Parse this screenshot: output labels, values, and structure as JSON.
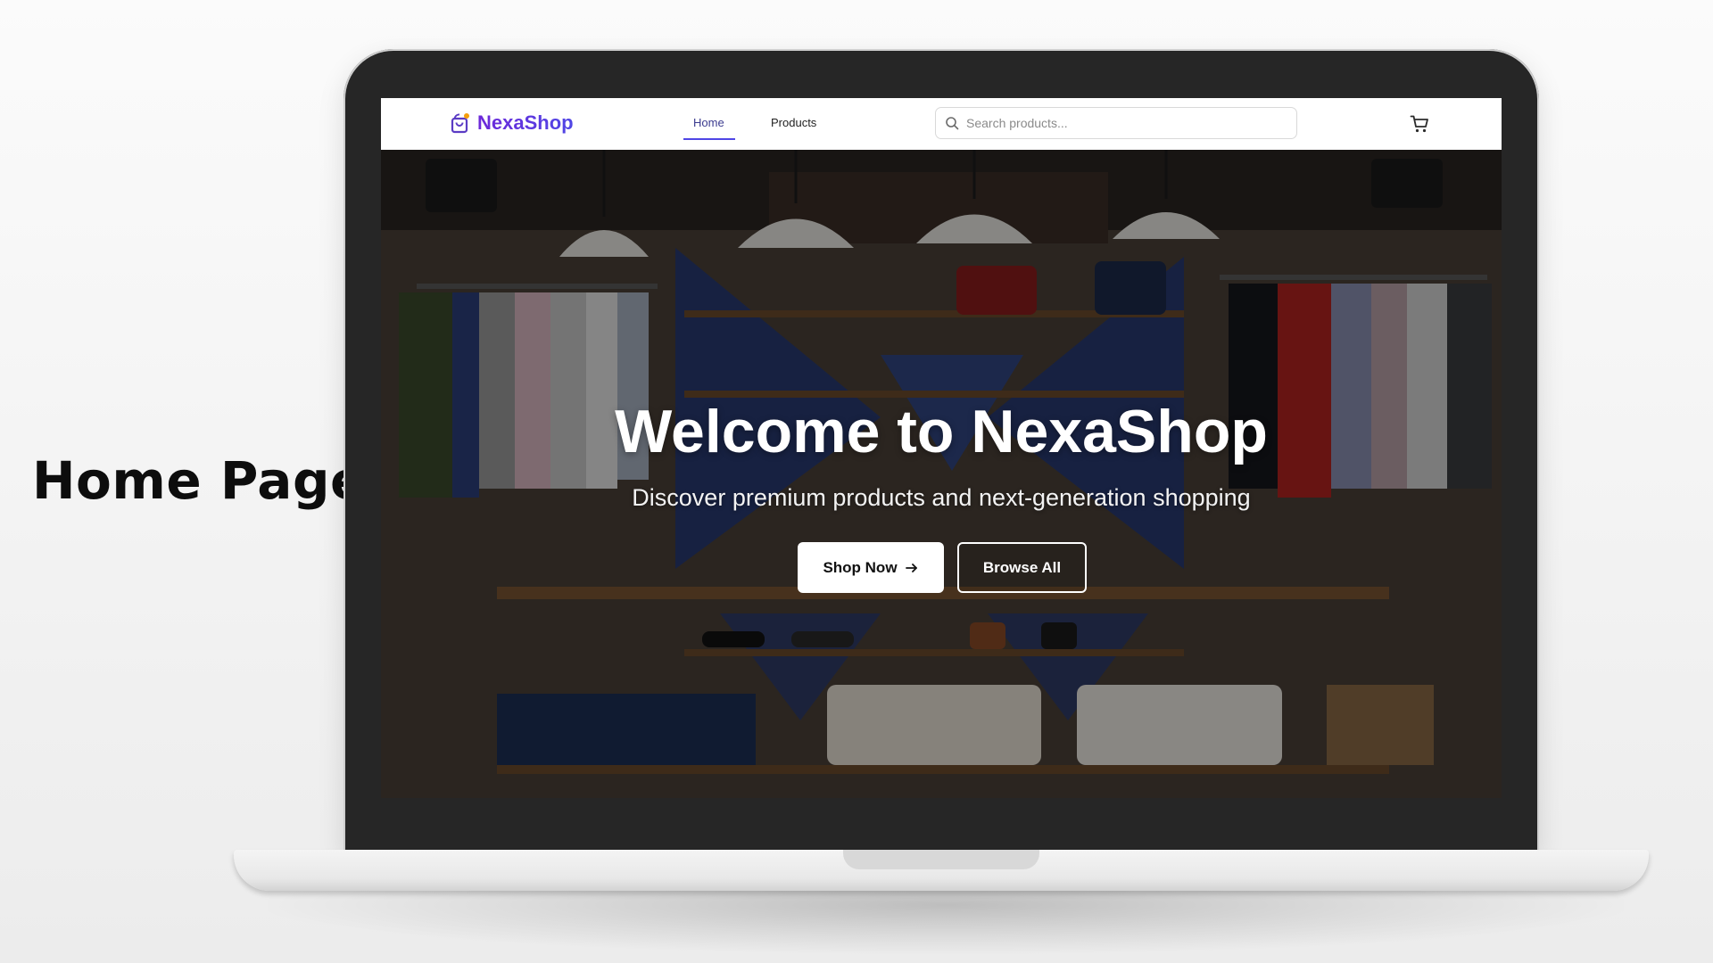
{
  "side_label": "Home Page",
  "navbar": {
    "brand_name": "NexaShop",
    "links": [
      {
        "label": "Home",
        "active": true
      },
      {
        "label": "Products",
        "active": false
      }
    ],
    "search": {
      "placeholder": "Search products...",
      "value": ""
    }
  },
  "icons": {
    "brand": "shopping-bag-icon",
    "search": "search-icon",
    "cart": "shopping-cart-icon",
    "arrow": "arrow-right-icon"
  },
  "hero": {
    "title": "Welcome to NexaShop",
    "subtitle": "Discover premium products and next-generation shopping",
    "primary_button": "Shop Now",
    "secondary_button": "Browse All"
  },
  "colors": {
    "brand_start": "#6d28d9",
    "brand_end": "#4f46e5",
    "active_nav": "#4f46e5",
    "laptop_bezel": "#262626"
  }
}
